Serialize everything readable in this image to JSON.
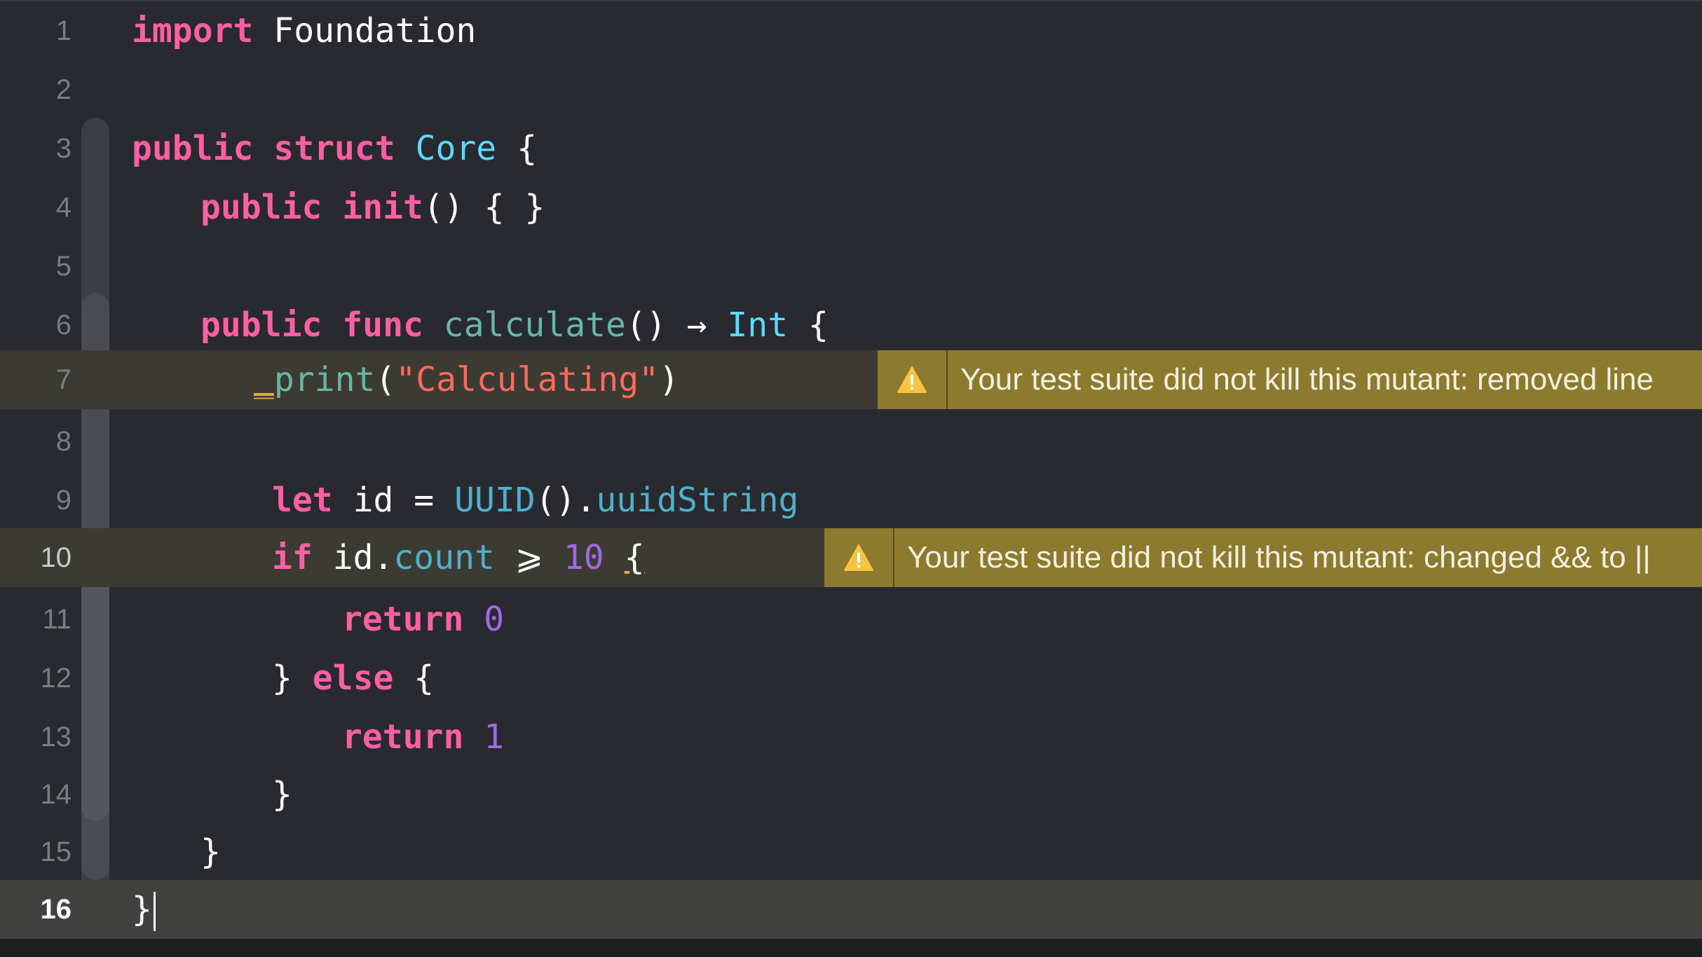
{
  "editor": {
    "lines": [
      {
        "number": "1"
      },
      {
        "number": "2"
      },
      {
        "number": "3"
      },
      {
        "number": "4"
      },
      {
        "number": "5"
      },
      {
        "number": "6"
      },
      {
        "number": "7"
      },
      {
        "number": "8"
      },
      {
        "number": "9"
      },
      {
        "number": "10"
      },
      {
        "number": "11"
      },
      {
        "number": "12"
      },
      {
        "number": "13"
      },
      {
        "number": "14"
      },
      {
        "number": "15"
      },
      {
        "number": "16"
      }
    ],
    "code": {
      "l1": {
        "kw": "import",
        "rest": " Foundation"
      },
      "l3": {
        "kw1": "public",
        "kw2": "struct",
        "type": "Core",
        "rest": " {"
      },
      "l4": {
        "kw": "public",
        "fn": "init",
        "rest": "() { }"
      },
      "l6": {
        "kw1": "public",
        "kw2": "func",
        "fn": "calculate",
        "mid": "() → ",
        "type": "Int",
        "rest": " {"
      },
      "l7": {
        "under": "_",
        "fn": "print",
        "open": "(",
        "str": "\"Calculating\"",
        "close": ")"
      },
      "l9": {
        "kw": "let",
        "mid": " id = ",
        "type": "UUID",
        "mid2": "().",
        "prop": "uuidString"
      },
      "l10": {
        "kw": "if",
        "mid": " id.",
        "prop": "count",
        "op": " ⩾ ",
        "num": "10",
        "sp": " ",
        "brace": "{"
      },
      "l11": {
        "kw": "return",
        "num": "0"
      },
      "l12": {
        "pre": "} ",
        "kw": "else",
        "rest": " {"
      },
      "l13": {
        "kw": "return",
        "num": "1"
      },
      "l14": {
        "rest": "}"
      },
      "l15": {
        "rest": "}"
      },
      "l16": {
        "rest": "}"
      }
    },
    "current_line": 16
  },
  "warnings": [
    {
      "line": "7",
      "icon": "warning-icon",
      "message": "Your test suite did not kill this mutant: removed line"
    },
    {
      "line": "10",
      "icon": "warning-icon",
      "message": "Your test suite did not kill this mutant: changed && to ||"
    }
  ],
  "colors": {
    "background": "#292a30",
    "keyword": "#fc5fa3",
    "type": "#5dd8ff",
    "function": "#67b7a4",
    "string": "#fc6a5d",
    "number": "#a167e6",
    "warning_banner": "#8c7a2e"
  }
}
